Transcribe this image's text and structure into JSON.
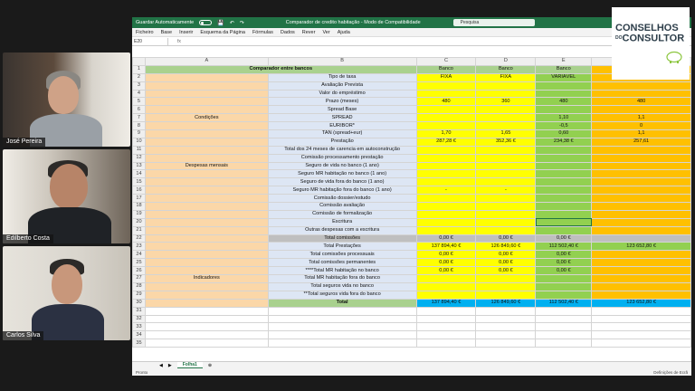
{
  "participants": [
    {
      "name": "José Pereira"
    },
    {
      "name": "Edilberto Costa"
    },
    {
      "name": "Carlos Silva"
    }
  ],
  "logo": {
    "line1": "CONSELHOS",
    "line2_prefix": "DO",
    "line2": "CONSULTOR"
  },
  "excel": {
    "autosave_label": "Guardar Automaticamente",
    "title": "Comparador de credito habitação  -  Modo de Compatibilidade",
    "search_placeholder": "Pesquisa",
    "menu": [
      "Ficheiro",
      "Base",
      "Inserir",
      "Esquema da Página",
      "Fórmulas",
      "Dados",
      "Rever",
      "Ver",
      "Ajuda"
    ],
    "namebox": "E20",
    "fx": "fx",
    "columns": [
      "",
      "A",
      "B",
      "C",
      "D",
      "E",
      ""
    ],
    "sheet_tab": "Folha1",
    "status_left": "Pronto",
    "status_right": "Definições de Ecrã"
  },
  "sheet": {
    "title": "Comparador entre bancos",
    "bank_header": "Banco",
    "rate_types": [
      "FIXA",
      "FIXA",
      "VARIÁVEL"
    ],
    "groups": {
      "condicoes": "Condições",
      "despesas": "Despesas mensais",
      "indicadores": "Indicadores"
    },
    "rows": {
      "r2": "Tipo de taxa",
      "r3": "Avaliação Prevista",
      "r4": "Valor do empréstimo",
      "r5": "Prazo (meses)",
      "r6": "Spread Base",
      "r7": "SPREAD",
      "r8": "EURIBOR*",
      "r9": "TAN (spread+eur)",
      "r10": "Prestação",
      "r11": "Total dos 24 meses de carencia em autoconstrução",
      "r12": "Comissão processamento prestação",
      "r13": "Seguro de vida no banco (1 ano)",
      "r14": "Seguro MR habitação no banco (1 ano)",
      "r15": "Seguro de vida fora do banco (1 ano)",
      "r16": "Seguro MR habitação fora do banco (1 ano)",
      "r17": "Comissão dossier/estudo",
      "r18": "Comissão avaliação",
      "r19": "Comissão de formalização",
      "r20": "Escritura",
      "r21": "Outras despesas com a escritura",
      "r22": "Total comissões",
      "r23": "Total Prestações",
      "r24": "Total comissões processuais",
      "r25": "Total comissões permanentes",
      "r26": "****Total MR habitação no banco",
      "r27": "Total MR habitação fora do banco",
      "r28": "Total seguros vida no banco",
      "r29": "**Total seguros vida fora do banco",
      "r30": "Total"
    },
    "values": {
      "prazo": [
        "480",
        "360",
        "480",
        "480"
      ],
      "spread": [
        "",
        "",
        "1,10",
        "1,1"
      ],
      "euribor": [
        "",
        "",
        "-0,5",
        "0"
      ],
      "tan": [
        "1,70",
        "1,65",
        "0,60",
        "1,1"
      ],
      "prestacao": [
        "287,28 €",
        "352,36 €",
        "234,38 €",
        "257,61"
      ],
      "r16": [
        "-",
        "-",
        "",
        ""
      ],
      "total_comissoes": [
        "0,00 €",
        "0,00 €",
        "0,00 €",
        ""
      ],
      "total_prestacoes": [
        "137 894,40 €",
        "126 849,60 €",
        "112 502,40 €",
        "123 652,80 €"
      ],
      "zero": "0,00 €",
      "total": [
        "137 894,40 €",
        "126 849,60 €",
        "112 502,40 €",
        "123 652,80 €"
      ]
    }
  },
  "colors": {
    "excel_green": "#217346",
    "header_green": "#a9d18e",
    "yellow": "#ffff00",
    "green": "#92d050",
    "orange": "#ffc000",
    "cyan": "#00b0f0"
  }
}
